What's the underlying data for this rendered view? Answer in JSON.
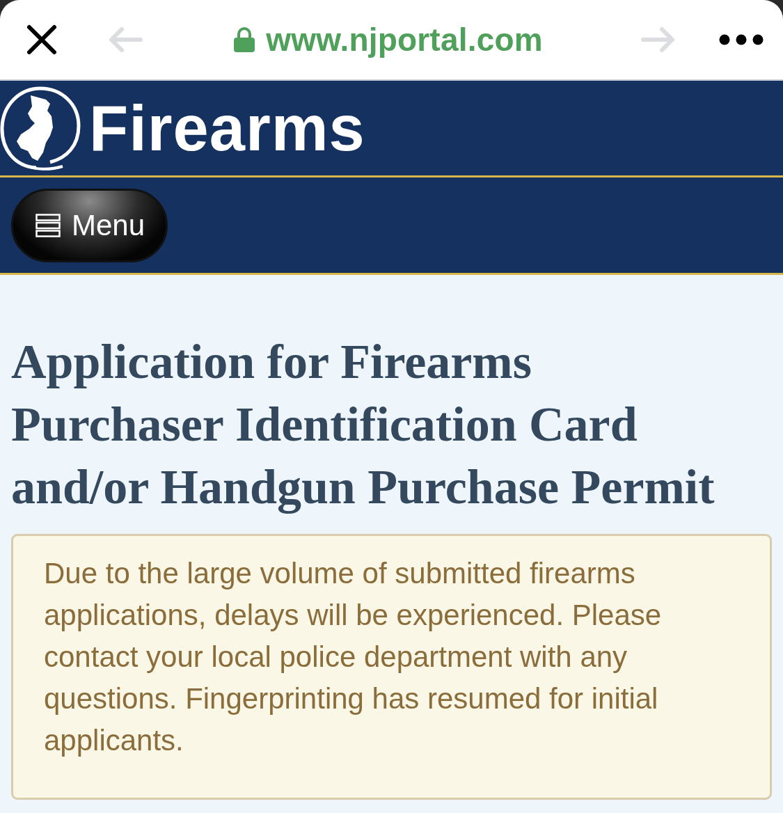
{
  "browser": {
    "url": "www.njportal.com",
    "secure": true,
    "back": {
      "disabled": true
    },
    "forward": {
      "disabled": true
    }
  },
  "header": {
    "title": "Firearms"
  },
  "nav": {
    "menu_button": "Menu"
  },
  "page": {
    "heading": "Application for Firearms Purchaser Identification Card and/or Handgun Purchase Permit",
    "notice": "Due to the large volume of submitted firearms applications, delays will be experienced. Please contact your local police department with any questions. Fingerprinting has resumed for initial applicants."
  }
}
